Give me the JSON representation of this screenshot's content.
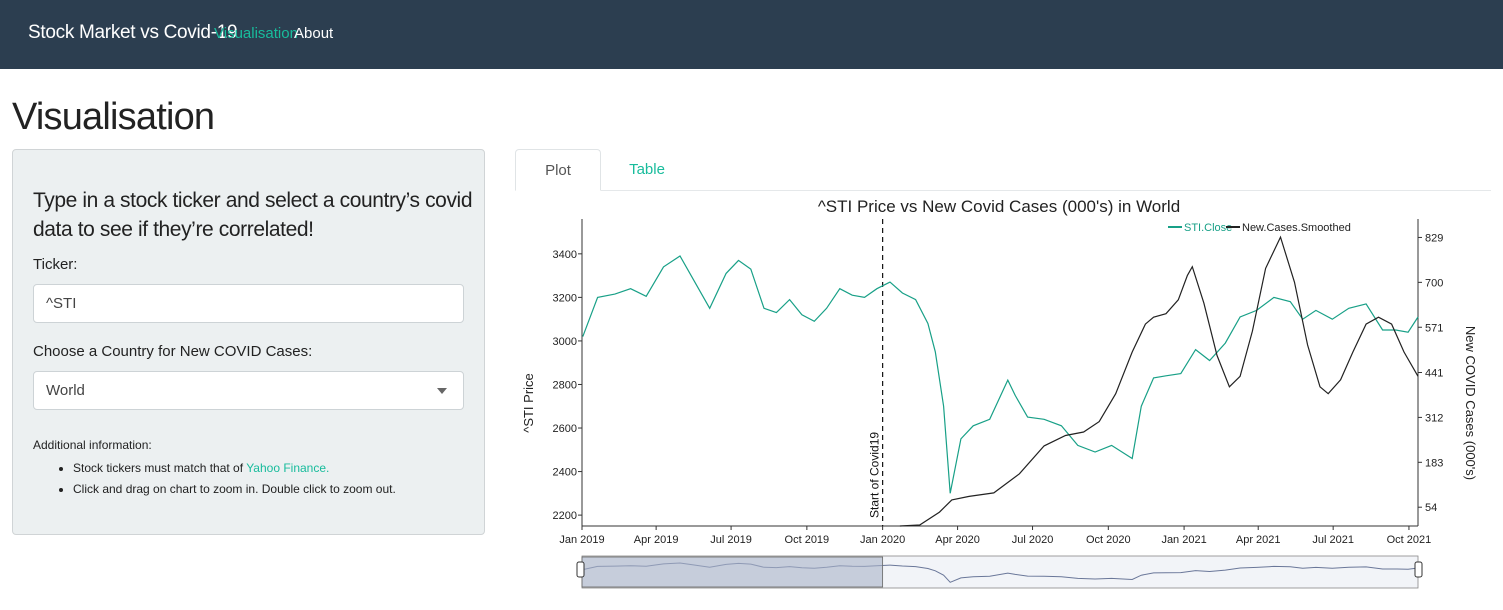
{
  "nav": {
    "brand": "Stock Market vs Covid-19",
    "links": [
      "Visualisation",
      "About"
    ]
  },
  "page": {
    "title": "Visualisation"
  },
  "sidebar": {
    "heading": "Type in a stock ticker and select a country’s covid data to see if they’re correlated!",
    "ticker_label": "Ticker:",
    "ticker_value": "^STI",
    "country_label": "Choose a Country for New COVID Cases:",
    "country_value": "World",
    "info_title": "Additional information:",
    "info_item1_prefix": "Stock tickers must match that of ",
    "info_item1_link": "Yahoo Finance.",
    "info_item2": "Click and drag on chart to zoom in. Double click to zoom out."
  },
  "tabs": [
    "Plot",
    "Table"
  ],
  "colors": {
    "navbar": "#2c3e50",
    "accent": "#18bc9c",
    "sti": "#18a087",
    "cases": "#222222"
  },
  "chart_data": {
    "type": "line",
    "title": "^STI Price vs New Covid Cases (000's) in World",
    "ylabel": "^STI Price",
    "y2label": "New COVID Cases (000's)",
    "annotation": "Start of Covid19",
    "annotation_date": "2020-01-01",
    "x_ticks": [
      "Jan 2019",
      "Apr 2019",
      "Jul 2019",
      "Oct 2019",
      "Jan 2020",
      "Apr 2020",
      "Jul 2020",
      "Oct 2020",
      "Jan 2021",
      "Apr 2021",
      "Jul 2021",
      "Oct 2021"
    ],
    "y_ticks": [
      2200,
      2400,
      2600,
      2800,
      3000,
      3200,
      3400
    ],
    "y2_ticks": [
      54,
      183,
      312,
      441,
      571,
      700,
      829
    ],
    "ylim": [
      2150,
      3560
    ],
    "y2lim": [
      0,
      882
    ],
    "xlim": [
      "2019-01-01",
      "2021-10-12"
    ],
    "legend_position": "top-right",
    "series": [
      {
        "name": "STI.Close",
        "color": "#18a087",
        "x": [
          "2019-01-02",
          "2019-01-20",
          "2019-02-10",
          "2019-03-01",
          "2019-03-20",
          "2019-04-10",
          "2019-04-30",
          "2019-05-15",
          "2019-06-05",
          "2019-06-25",
          "2019-07-10",
          "2019-07-25",
          "2019-08-10",
          "2019-08-25",
          "2019-09-10",
          "2019-09-25",
          "2019-10-10",
          "2019-10-25",
          "2019-11-10",
          "2019-11-25",
          "2019-12-10",
          "2019-12-25",
          "2020-01-10",
          "2020-01-25",
          "2020-02-10",
          "2020-02-25",
          "2020-03-05",
          "2020-03-15",
          "2020-03-23",
          "2020-04-05",
          "2020-04-20",
          "2020-05-10",
          "2020-06-01",
          "2020-06-10",
          "2020-06-25",
          "2020-07-15",
          "2020-08-05",
          "2020-08-25",
          "2020-09-15",
          "2020-10-05",
          "2020-10-30",
          "2020-11-10",
          "2020-11-25",
          "2020-12-10",
          "2020-12-28",
          "2021-01-15",
          "2021-02-01",
          "2021-02-20",
          "2021-03-10",
          "2021-03-30",
          "2021-04-20",
          "2021-05-10",
          "2021-05-25",
          "2021-06-10",
          "2021-06-30",
          "2021-07-20",
          "2021-08-10",
          "2021-08-30",
          "2021-09-15",
          "2021-09-30",
          "2021-10-12"
        ],
        "y": [
          3020,
          3200,
          3215,
          3240,
          3205,
          3340,
          3390,
          3290,
          3150,
          3310,
          3370,
          3330,
          3150,
          3130,
          3190,
          3120,
          3090,
          3150,
          3240,
          3210,
          3200,
          3240,
          3270,
          3220,
          3190,
          3080,
          2950,
          2700,
          2300,
          2550,
          2610,
          2640,
          2820,
          2750,
          2650,
          2640,
          2610,
          2520,
          2490,
          2520,
          2460,
          2700,
          2830,
          2840,
          2850,
          2960,
          2910,
          2990,
          3110,
          3140,
          3200,
          3180,
          3100,
          3140,
          3100,
          3150,
          3170,
          3050,
          3050,
          3040,
          3110
        ]
      },
      {
        "name": "New.Cases.Smoothed",
        "color": "#222222",
        "x": [
          "2020-01-22",
          "2020-02-15",
          "2020-03-10",
          "2020-03-25",
          "2020-04-15",
          "2020-05-15",
          "2020-06-15",
          "2020-07-15",
          "2020-08-10",
          "2020-09-01",
          "2020-09-20",
          "2020-10-10",
          "2020-10-30",
          "2020-11-15",
          "2020-11-25",
          "2020-12-10",
          "2020-12-25",
          "2021-01-05",
          "2021-01-11",
          "2021-01-25",
          "2021-02-10",
          "2021-02-25",
          "2021-03-10",
          "2021-03-25",
          "2021-04-10",
          "2021-04-28",
          "2021-05-15",
          "2021-05-31",
          "2021-06-15",
          "2021-06-25",
          "2021-07-10",
          "2021-07-25",
          "2021-08-10",
          "2021-08-25",
          "2021-09-10",
          "2021-09-25",
          "2021-10-12"
        ],
        "y": [
          0,
          3,
          40,
          75,
          85,
          95,
          150,
          230,
          260,
          270,
          300,
          380,
          500,
          580,
          600,
          610,
          650,
          720,
          745,
          640,
          490,
          400,
          430,
          560,
          740,
          830,
          700,
          520,
          400,
          380,
          420,
          500,
          580,
          600,
          580,
          500,
          430
        ]
      }
    ],
    "range_selector": {
      "window_start": "2019-01-01",
      "window_end": "2020-01-01"
    }
  }
}
